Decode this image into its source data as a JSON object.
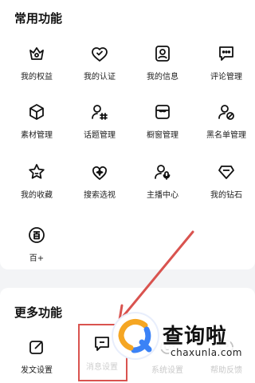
{
  "common": {
    "title": "常用功能",
    "items": [
      {
        "label": "我的权益",
        "icon": "crown-icon"
      },
      {
        "label": "我的认证",
        "icon": "verified-heart-icon"
      },
      {
        "label": "我的信息",
        "icon": "profile-card-icon"
      },
      {
        "label": "评论管理",
        "icon": "comment-icon"
      },
      {
        "label": "素材管理",
        "icon": "cube-icon"
      },
      {
        "label": "话题管理",
        "icon": "topic-hash-icon"
      },
      {
        "label": "橱窗管理",
        "icon": "shop-window-icon"
      },
      {
        "label": "黑名单管理",
        "icon": "blacklist-user-icon"
      },
      {
        "label": "我的收藏",
        "icon": "star-icon"
      },
      {
        "label": "搜索选视",
        "icon": "sparkle-heart-icon"
      },
      {
        "label": "主播中心",
        "icon": "host-mic-icon"
      },
      {
        "label": "我的钻石",
        "icon": "diamond-icon"
      },
      {
        "label": "百+",
        "icon": "baijia-icon"
      }
    ]
  },
  "more": {
    "title": "更多功能",
    "items": [
      {
        "label": "发文设置",
        "icon": "edit-icon"
      },
      {
        "label": "消息设置",
        "icon": "message-icon"
      },
      {
        "label": "系统设置",
        "icon": "settings-icon"
      },
      {
        "label": "帮助反馈",
        "icon": "help-icon"
      }
    ]
  },
  "watermark": {
    "text": "查询啦",
    "url": "chaxunla.com"
  },
  "colors": {
    "highlight": "#d9534f",
    "watermark_orange": "#f5a623",
    "watermark_blue": "#3b82f6"
  }
}
